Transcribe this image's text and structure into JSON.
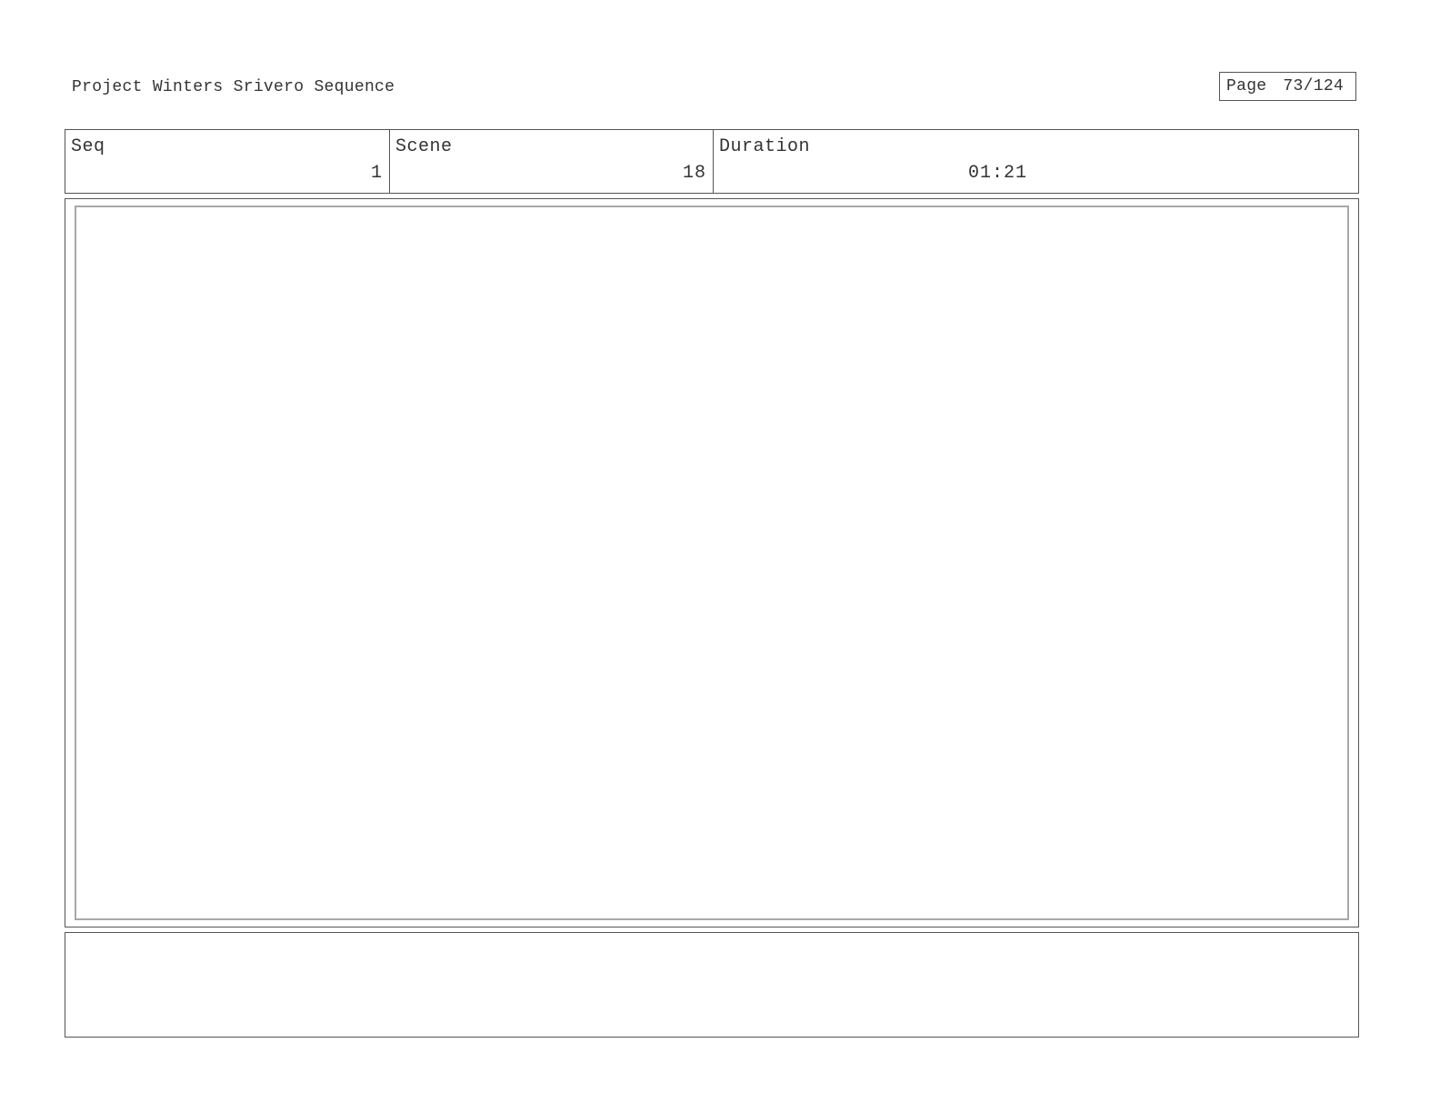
{
  "header": {
    "project_title": "Project Winters Srivero Sequence",
    "page_label": "Page",
    "page_number": "73/124"
  },
  "info": {
    "seq_label": "Seq",
    "seq_value": "1",
    "scene_label": "Scene",
    "scene_value": "18",
    "duration_label": "Duration",
    "duration_value": "01:21"
  },
  "frame": {
    "image": ""
  },
  "notes": {
    "text": ""
  }
}
